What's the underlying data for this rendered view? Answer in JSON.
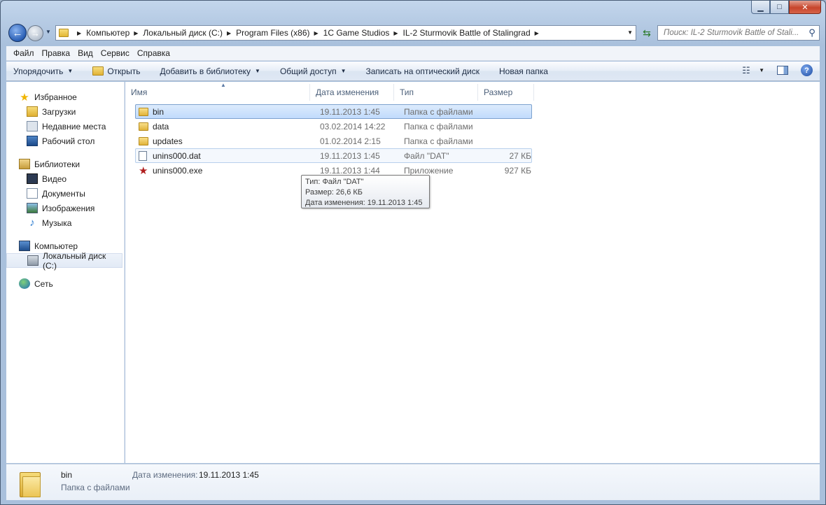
{
  "window": {
    "caption": {
      "minimize": "▁",
      "maximize": "□",
      "close": "✕"
    }
  },
  "address": {
    "crumbs": [
      "Компьютер",
      "Локальный диск (C:)",
      "Program Files (x86)",
      "1C Game Studios",
      "IL-2 Sturmovik Battle of Stalingrad"
    ]
  },
  "search": {
    "placeholder": "Поиск: IL-2 Sturmovik Battle of Stali..."
  },
  "menu": [
    "Файл",
    "Правка",
    "Вид",
    "Сервис",
    "Справка"
  ],
  "toolbar": {
    "organize": "Упорядочить",
    "open": "Открыть",
    "add_to_library": "Добавить в библиотеку",
    "share": "Общий доступ",
    "burn": "Записать на оптический диск",
    "new_folder": "Новая папка"
  },
  "navpane": {
    "favorites": {
      "title": "Избранное",
      "items": [
        "Загрузки",
        "Недавние места",
        "Рабочий стол"
      ]
    },
    "libraries": {
      "title": "Библиотеки",
      "items": [
        "Видео",
        "Документы",
        "Изображения",
        "Музыка"
      ]
    },
    "computer": {
      "title": "Компьютер",
      "items": [
        "Локальный диск (C:)"
      ]
    },
    "network": {
      "title": "Сеть"
    }
  },
  "columns": {
    "name": "Имя",
    "date": "Дата изменения",
    "type": "Тип",
    "size": "Размер"
  },
  "files": [
    {
      "name": "bin",
      "date": "19.11.2013 1:45",
      "type": "Папка с файлами",
      "size": ""
    },
    {
      "name": "data",
      "date": "03.02.2014 14:22",
      "type": "Папка с файлами",
      "size": ""
    },
    {
      "name": "updates",
      "date": "01.02.2014 2:15",
      "type": "Папка с файлами",
      "size": ""
    },
    {
      "name": "unins000.dat",
      "date": "19.11.2013 1:45",
      "type": "Файл \"DAT\"",
      "size": "27 КБ"
    },
    {
      "name": "unins000.exe",
      "date": "19.11.2013 1:44",
      "type": "Приложение",
      "size": "927 КБ"
    }
  ],
  "tooltip": {
    "line1": "Тип: Файл \"DAT\"",
    "line2": "Размер: 26,6 КБ",
    "line3": "Дата изменения: 19.11.2013 1:45"
  },
  "details": {
    "name": "bin",
    "type": "Папка с файлами",
    "date_label": "Дата изменения:",
    "date_value": "19.11.2013 1:45"
  }
}
